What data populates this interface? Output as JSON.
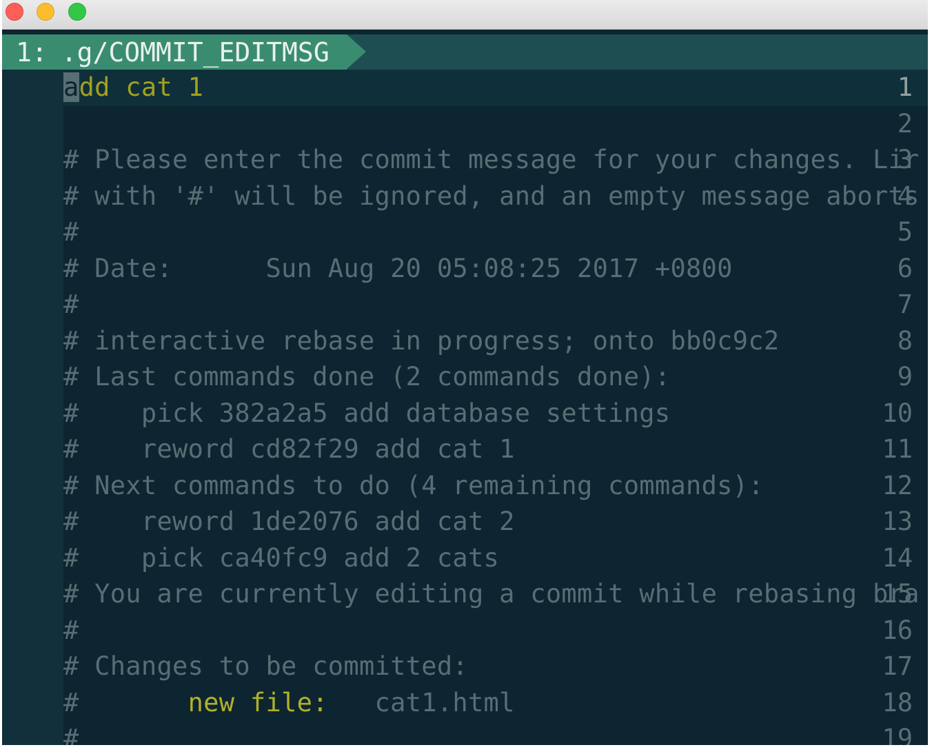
{
  "colors": {
    "background": "#0d2530",
    "gutter": "#12303b",
    "comment": "#586e75",
    "subject": "#a4a01f",
    "tab_active": "#3a8c70",
    "tab_bar": "#1f4e52"
  },
  "window": {
    "controls": [
      "close",
      "minimize",
      "maximize"
    ]
  },
  "tabline": {
    "tab_number": "1:",
    "tab_name": ".g/COMMIT_EDITMSG"
  },
  "editor": {
    "subject_cursor_char": "a",
    "subject_rest": "dd cat 1",
    "lines": [
      {
        "num": "1",
        "text": ""
      },
      {
        "num": "2",
        "text": ""
      },
      {
        "num": "3",
        "text": "# Please enter the commit message for your changes. Lir"
      },
      {
        "num": "4",
        "text": "# with '#' will be ignored, and an empty message aborts"
      },
      {
        "num": "5",
        "text": "#"
      },
      {
        "num": "6",
        "text": "# Date:      Sun Aug 20 05:08:25 2017 +0800"
      },
      {
        "num": "7",
        "text": "#"
      },
      {
        "num": "8",
        "text": "# interactive rebase in progress; onto bb0c9c2"
      },
      {
        "num": "9",
        "text": "# Last commands done (2 commands done):"
      },
      {
        "num": "10",
        "text": "#    pick 382a2a5 add database settings"
      },
      {
        "num": "11",
        "text": "#    reword cd82f29 add cat 1"
      },
      {
        "num": "12",
        "text": "# Next commands to do (4 remaining commands):"
      },
      {
        "num": "13",
        "text": "#    reword 1de2076 add cat 2"
      },
      {
        "num": "14",
        "text": "#    pick ca40fc9 add 2 cats"
      },
      {
        "num": "15",
        "text": "# You are currently editing a commit while rebasing bra"
      },
      {
        "num": "16",
        "text": "#"
      },
      {
        "num": "17",
        "text": "# Changes to be committed:"
      },
      {
        "num": "18",
        "hash": "#",
        "pad": "       ",
        "label": "new file:",
        "file": "   cat1.html"
      },
      {
        "num": "19",
        "text": "#"
      }
    ]
  }
}
